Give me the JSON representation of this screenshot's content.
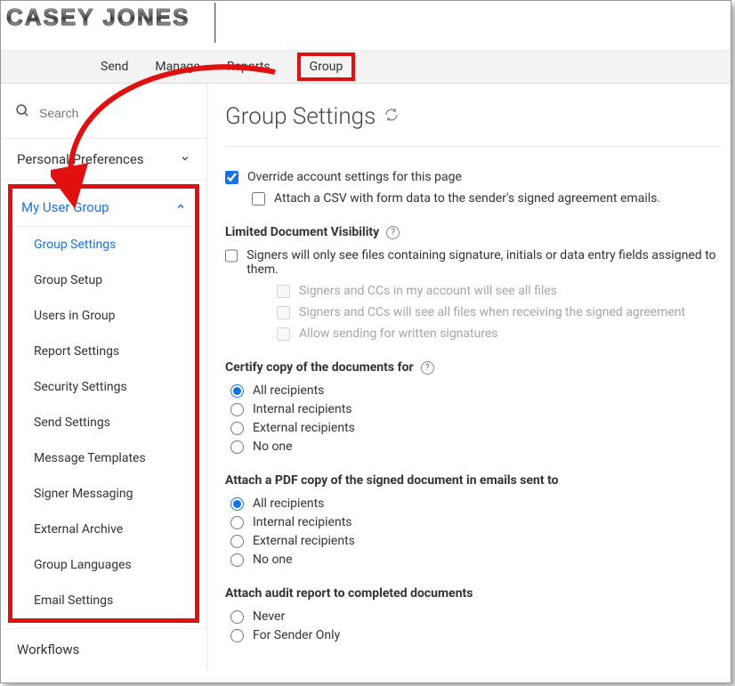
{
  "brand": {
    "name": "CASEY JONES"
  },
  "topnav": {
    "items": [
      "Send",
      "Manage",
      "Reports",
      "Group"
    ],
    "highlighted": "Group"
  },
  "sidebar": {
    "search_placeholder": "Search",
    "personal_prefs_label": "Personal Preferences",
    "my_user_group_label": "My User Group",
    "items": [
      "Group Settings",
      "Group Setup",
      "Users in Group",
      "Report Settings",
      "Security Settings",
      "Send Settings",
      "Message Templates",
      "Signer Messaging",
      "External Archive",
      "Group Languages",
      "Email Settings"
    ],
    "workflows_label": "Workflows"
  },
  "main": {
    "title": "Group Settings",
    "override_label": "Override account settings for this page",
    "attach_csv_label": "Attach a CSV with form data to the sender's signed agreement emails.",
    "limited_visibility": {
      "heading": "Limited Document Visibility",
      "main_label": "Signers will only see files containing signature, initials or data entry fields assigned to them.",
      "sub1": "Signers and CCs in my account will see all files",
      "sub2": "Signers and CCs will see all files when receiving the signed agreement",
      "sub3": "Allow sending for written signatures"
    },
    "certify": {
      "heading": "Certify copy of the documents for",
      "options": [
        "All recipients",
        "Internal recipients",
        "External recipients",
        "No one"
      ],
      "selected": "All recipients"
    },
    "attach_pdf": {
      "heading": "Attach a PDF copy of the signed document in emails sent to",
      "options": [
        "All recipients",
        "Internal recipients",
        "External recipients",
        "No one"
      ],
      "selected": "All recipients"
    },
    "audit": {
      "heading": "Attach audit report to completed documents",
      "options": [
        "Never",
        "For Sender Only"
      ],
      "selected": ""
    }
  }
}
